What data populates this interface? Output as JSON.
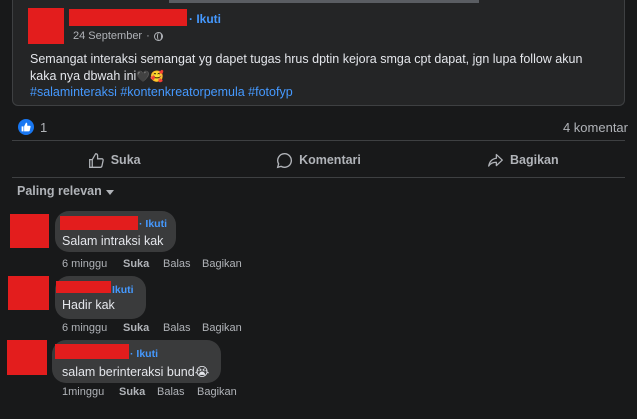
{
  "post": {
    "follow_label": "Ikuti",
    "date": "24 September",
    "text": "Semangat interaksi semangat yg dapet tugas hrus dptin kejora smga cpt dapat, jgn lupa follow akun kaka nya dbwah ini",
    "emoji": "🖤🥰",
    "hashtags": "#salaminteraksi #kontenkreatorpemula #fotofyp"
  },
  "stats": {
    "likes": "1",
    "comments": "4 komentar"
  },
  "actions": {
    "like": "Suka",
    "comment": "Komentari",
    "share": "Bagikan"
  },
  "sort_label": "Paling relevan",
  "comments": [
    {
      "follow": "Ikuti",
      "text": "Salam intraksi kak",
      "time": "6 minggu",
      "like": "Suka",
      "reply": "Balas",
      "share": "Bagikan"
    },
    {
      "follow": "Ikuti",
      "text": "Hadir kak",
      "time": "6 minggu",
      "like": "Suka",
      "reply": "Balas",
      "share": "Bagikan"
    },
    {
      "follow": "Ikuti",
      "text": "salam berinteraksi bund😭",
      "time": "1minggu",
      "like": "Suka",
      "reply": "Balas",
      "share": "Bagikan"
    }
  ],
  "colors": {
    "redaction": "#e31d1d",
    "link": "#4599ff",
    "like_blue": "#1877f2"
  }
}
